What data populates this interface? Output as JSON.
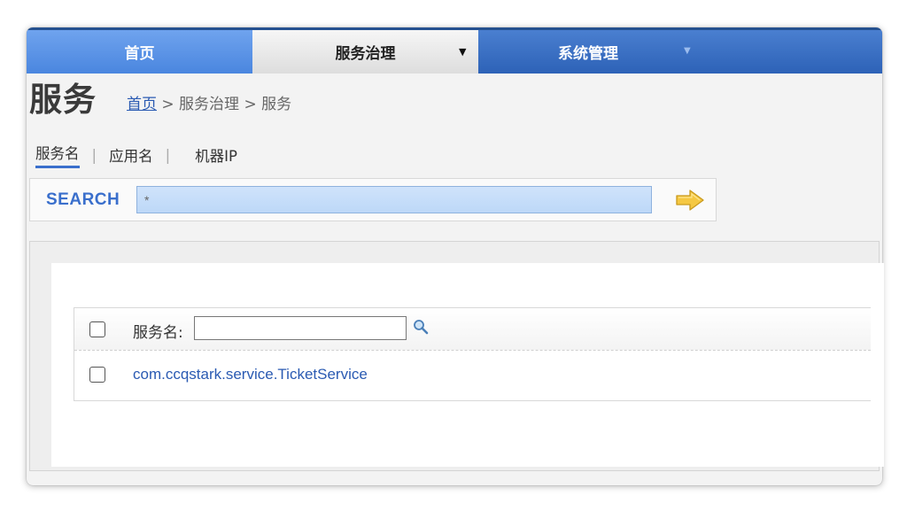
{
  "nav": {
    "home": "首页",
    "service_governance": "服务治理",
    "service_governance_caret": "▼",
    "system_management": "系统管理",
    "system_management_caret": "▼"
  },
  "page": {
    "title": "服务",
    "breadcrumb": {
      "home_link": "首页",
      "rest": " > 服务治理 > 服务"
    }
  },
  "search_tabs": [
    {
      "label": "服务名",
      "active": true
    },
    {
      "label": "应用名",
      "active": false
    },
    {
      "label": "机器IP",
      "active": false
    }
  ],
  "search": {
    "label": "SEARCH",
    "value": "*"
  },
  "list": {
    "filter_label": "服务名:",
    "filter_value": "",
    "rows": [
      {
        "service": "com.ccqstark.service.TicketService"
      }
    ]
  },
  "colors": {
    "nav_blue": "#2f65bb",
    "link_blue": "#2a5ab2",
    "search_label": "#3a6fcc",
    "arrow_yellow": "#f5c842"
  }
}
